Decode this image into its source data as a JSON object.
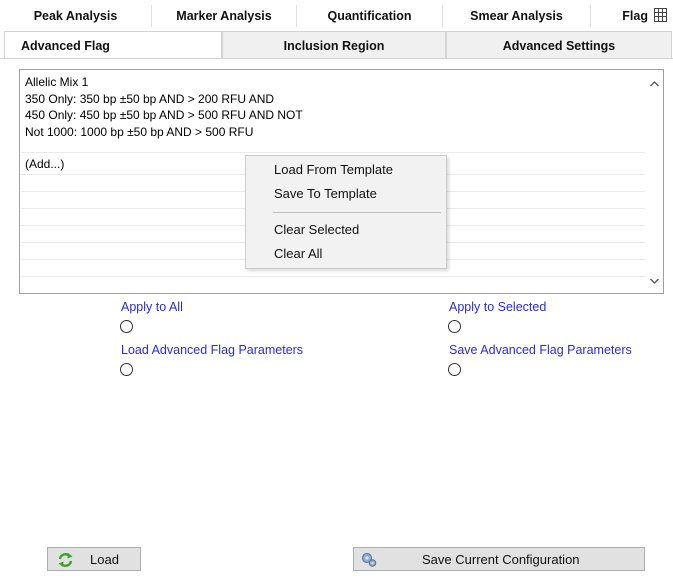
{
  "tabs_row1": [
    {
      "label": "Peak Analysis"
    },
    {
      "label": "Marker Analysis"
    },
    {
      "label": "Quantification"
    },
    {
      "label": "Smear Analysis"
    },
    {
      "label": "Flag"
    }
  ],
  "tabs_row2": [
    {
      "label": "Advanced Flag",
      "active": true
    },
    {
      "label": "Inclusion Region"
    },
    {
      "label": "Advanced Settings"
    }
  ],
  "flag_list": {
    "text": "Allelic Mix 1\n350 Only: 350 bp ±50 bp AND > 200 RFU AND\n450 Only: 450 bp ±50 bp AND > 500 RFU AND NOT\nNot 1000: 1000 bp ±50 bp AND > 500 RFU",
    "add_label": "(Add...)"
  },
  "context_menu": {
    "items": [
      "Load From Template",
      "Save To Template",
      "Clear Selected",
      "Clear All"
    ]
  },
  "actions": {
    "apply_all": "Apply to All",
    "apply_selected": "Apply to Selected",
    "load_params": "Load Advanced Flag Parameters",
    "save_params": "Save Advanced Flag Parameters"
  },
  "buttons": {
    "load": "Load",
    "save_config": "Save Current Configuration"
  },
  "colors": {
    "link": "#2a2ae6",
    "menu_bg": "#f2f2f2",
    "button_bg": "#e1e1e1"
  },
  "icons": {
    "tab_overflow": "grid-icon",
    "load": "refresh-arrows-icon",
    "save": "gears-icon"
  }
}
